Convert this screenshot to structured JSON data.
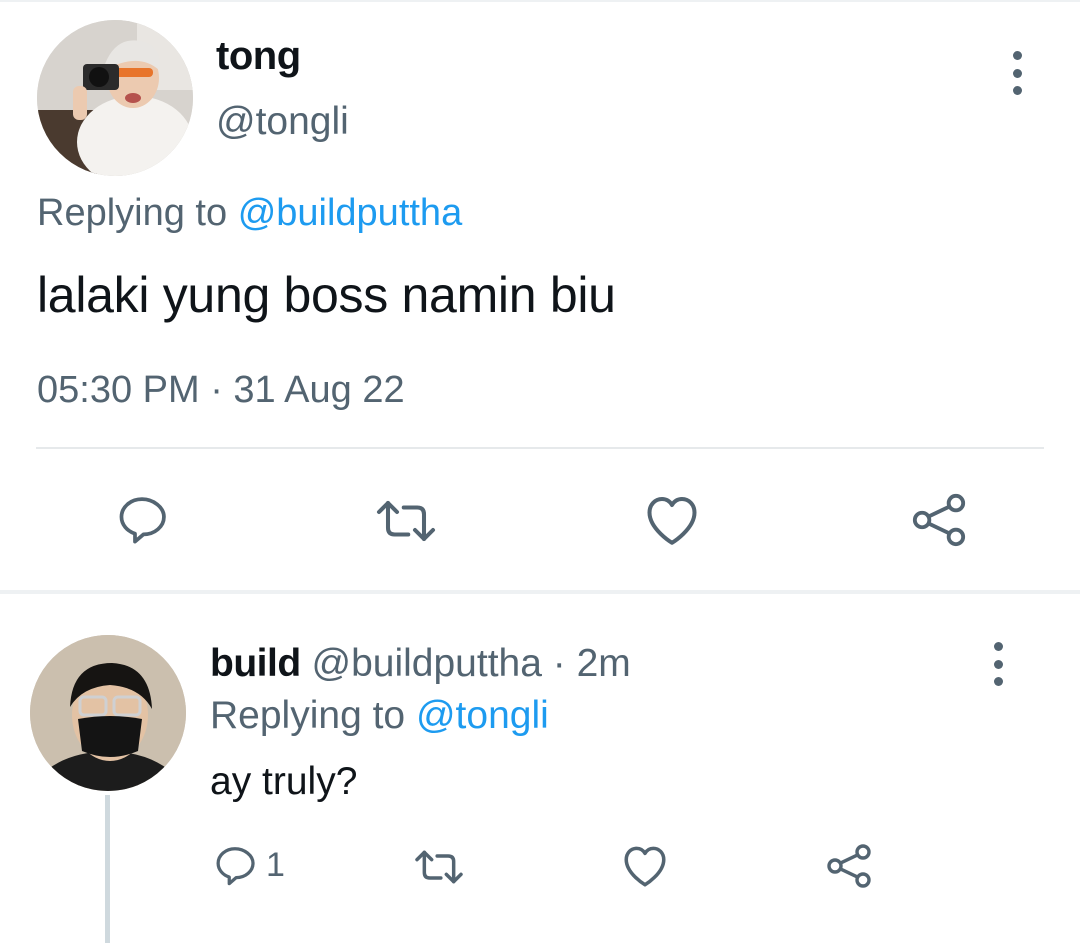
{
  "main_tweet": {
    "author_name": "tong",
    "author_handle": "@tongli",
    "replying_prefix": "Replying to",
    "replying_handle": "@buildputtha",
    "text": "lalaki yung boss namin biu",
    "timestamp": "05:30 PM · 31 Aug 22",
    "icons": {
      "reply": "reply-icon",
      "retweet": "retweet-icon",
      "like": "heart-icon",
      "share": "share-icon",
      "more": "more-icon"
    }
  },
  "reply_tweet": {
    "author_name": "build",
    "author_handle": "@buildputtha",
    "time_separator": "·",
    "time_ago": "2m",
    "replying_prefix": "Replying to",
    "replying_handle": "@tongli",
    "text": "ay truly?",
    "reply_count": "1",
    "icons": {
      "reply": "reply-icon",
      "retweet": "retweet-icon",
      "like": "heart-icon",
      "share": "share-icon",
      "more": "more-icon"
    }
  },
  "colors": {
    "text": "#0f1419",
    "muted": "#536471",
    "link": "#1d9bf0",
    "divider": "#e6e9eb"
  }
}
